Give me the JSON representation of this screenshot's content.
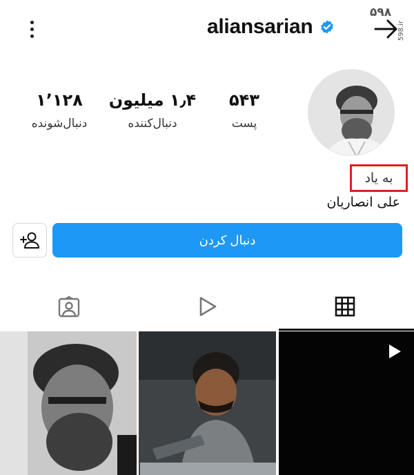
{
  "header": {
    "username": "aliansarian",
    "watermark_text": "۵۹۸",
    "watermark_site": "598.ir"
  },
  "profile": {
    "stats": [
      {
        "key": "posts",
        "value": "۵۴۳",
        "label": "پست"
      },
      {
        "key": "followers",
        "value": "۱٫۴ میلیون",
        "label": "دنبال‌کننده"
      },
      {
        "key": "following",
        "value": "۱٬۱۲۸",
        "label": "دنبال‌شونده"
      }
    ],
    "memorial_label": "به یاد",
    "full_name": "علی انصاریان"
  },
  "actions": {
    "follow_label": "دنبال کردن"
  },
  "tabs": [
    {
      "name": "tagged",
      "icon": "tagged-person-icon",
      "active": false
    },
    {
      "name": "reels",
      "icon": "play-icon",
      "active": false
    },
    {
      "name": "grid",
      "icon": "grid-icon",
      "active": true
    }
  ],
  "colors": {
    "follow_button": "#1e98f5",
    "verified_badge": "#1e98f5",
    "highlight_box": "#e0201d"
  }
}
